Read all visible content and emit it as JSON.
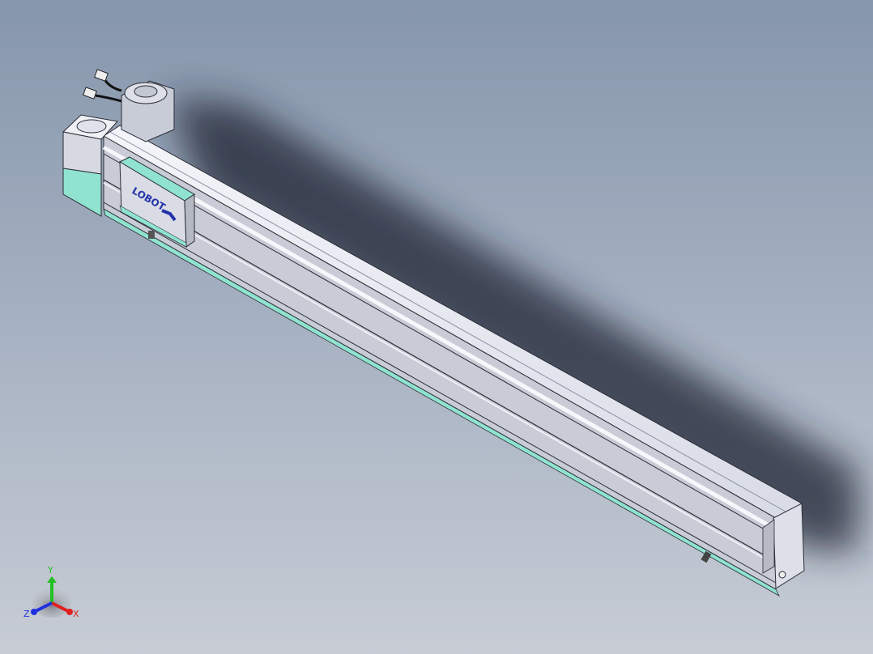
{
  "viewport": {
    "model": {
      "slider_logo": "LOBOT",
      "colors": {
        "accent_teal": "#8fe3cf",
        "body_light": "#e6e8f0",
        "body_mid": "#c9ccd6",
        "edge": "#2a2d35",
        "logo_blue": "#2233aa"
      }
    },
    "triad": {
      "x_label": "X",
      "y_label": "Y",
      "z_label": "Z",
      "colors": {
        "x": "#e02020",
        "y": "#22c022",
        "z": "#2030e0"
      }
    }
  }
}
